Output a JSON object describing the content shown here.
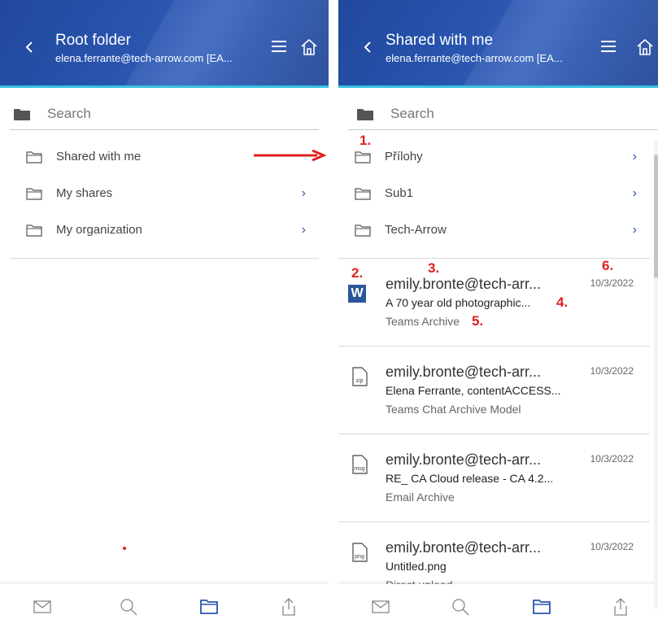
{
  "left": {
    "header": {
      "title": "Root folder",
      "subtitle": "elena.ferrante@tech-arrow.com [EA..."
    },
    "search": {
      "placeholder": "Search"
    },
    "folders": [
      {
        "label": "Shared with me"
      },
      {
        "label": "My shares"
      },
      {
        "label": "My organization"
      }
    ]
  },
  "right": {
    "header": {
      "title": "Shared with me",
      "subtitle": "elena.ferrante@tech-arrow.com [EA..."
    },
    "search": {
      "placeholder": "Search"
    },
    "folders": [
      {
        "label": "Přílohy"
      },
      {
        "label": "Sub1"
      },
      {
        "label": "Tech-Arrow"
      }
    ],
    "files": [
      {
        "icon": "word-icon",
        "sender": "emily.bronte@tech-arr...",
        "date": "10/3/2022",
        "subject": "A 70 year old photographic...",
        "type": "Teams Archive"
      },
      {
        "icon": "zip-file-icon",
        "icon_text": "zip",
        "sender": "emily.bronte@tech-arr...",
        "date": "10/3/2022",
        "subject": "Elena Ferrante, contentACCESS...",
        "type": "Teams Chat Archive Model"
      },
      {
        "icon": "msg-file-icon",
        "icon_text": "msg",
        "sender": "emily.bronte@tech-arr...",
        "date": "10/3/2022",
        "subject": "RE_ CA Cloud release - CA 4.2...",
        "type": "Email Archive"
      },
      {
        "icon": "png-file-icon",
        "icon_text": "png",
        "sender": "emily.bronte@tech-arr...",
        "date": "10/3/2022",
        "subject": "Untitled.png",
        "type": "Direct upload"
      }
    ]
  },
  "markers": [
    "1.",
    "2.",
    "3.",
    "4.",
    "5.",
    "6."
  ],
  "colors": {
    "header": "#2a56b0",
    "accent_line": "#33c0e0",
    "annotation": "#e0201e",
    "nav_active": "#2a56b0"
  },
  "nav": [
    {
      "icon": "mail-icon"
    },
    {
      "icon": "search-icon"
    },
    {
      "icon": "folder-icon",
      "active": true
    },
    {
      "icon": "share-icon"
    }
  ]
}
